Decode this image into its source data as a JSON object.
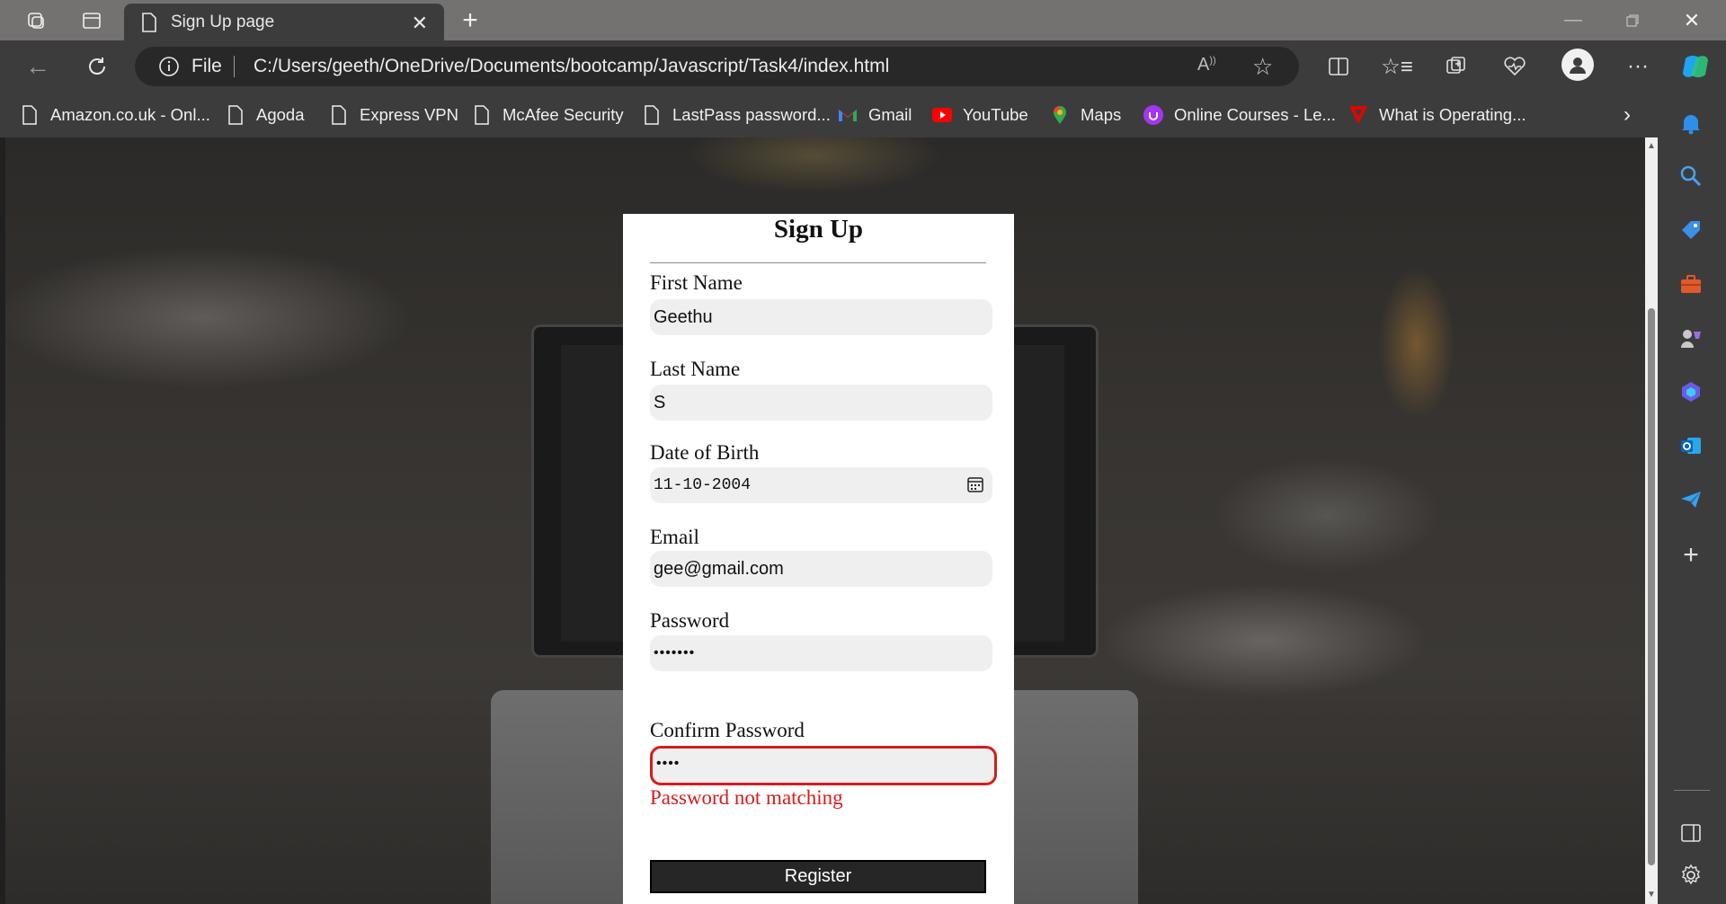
{
  "browser": {
    "tab_title": "Sign Up page",
    "address_scheme": "File",
    "url": "C:/Users/geeth/OneDrive/Documents/bootcamp/Javascript/Task4/index.html",
    "bookmarks": [
      {
        "label": "Amazon.co.uk - Onl...",
        "icon": "page-icon"
      },
      {
        "label": "Agoda",
        "icon": "page-icon"
      },
      {
        "label": "Express VPN",
        "icon": "page-icon"
      },
      {
        "label": "McAfee Security",
        "icon": "page-icon"
      },
      {
        "label": "LastPass password...",
        "icon": "page-icon"
      },
      {
        "label": "Gmail",
        "icon": "gmail-icon"
      },
      {
        "label": "YouTube",
        "icon": "youtube-icon"
      },
      {
        "label": "Maps",
        "icon": "maps-icon"
      },
      {
        "label": "Online Courses - Le...",
        "icon": "udemy-icon"
      },
      {
        "label": "What is Operating...",
        "icon": "vivaldi-icon"
      }
    ]
  },
  "form": {
    "title": "Sign Up",
    "first_name": {
      "label": "First Name",
      "value": "Geethu"
    },
    "last_name": {
      "label": "Last Name",
      "value": "S"
    },
    "dob": {
      "label": "Date of Birth",
      "value": "11-10-2004"
    },
    "email": {
      "label": "Email",
      "value": "gee@gmail.com"
    },
    "password": {
      "label": "Password",
      "value": "•••••••"
    },
    "confirm_password": {
      "label": "Confirm Password",
      "value": "••••"
    },
    "error_message": "Password not matching",
    "register_label": "Register"
  },
  "colors": {
    "error": "#d81b1b",
    "button": "#262626",
    "input_bg": "#efefef"
  }
}
